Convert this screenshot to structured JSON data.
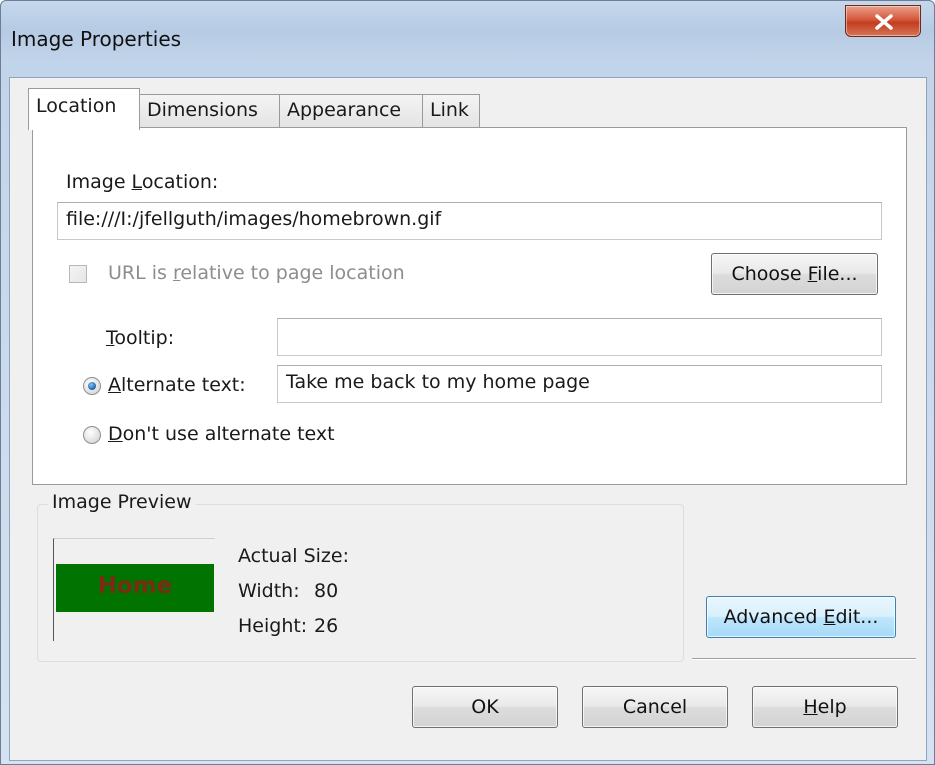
{
  "window": {
    "title": "Image Properties",
    "close_label": "X"
  },
  "tabs": [
    {
      "label": "Location",
      "active": true
    },
    {
      "label": "Dimensions",
      "active": false
    },
    {
      "label": "Appearance",
      "active": false
    },
    {
      "label": "Link",
      "active": false
    }
  ],
  "location": {
    "image_location_label_pre": "Image ",
    "image_location_label_key": "L",
    "image_location_label_post": "ocation:",
    "image_location_value": "file:///I:/jfellguth/images/homebrown.gif",
    "relative_label_pre": "URL is ",
    "relative_label_key": "r",
    "relative_label_post": "elative to page location",
    "relative_checked": false,
    "choose_file_pre": "Choose ",
    "choose_file_key": "F",
    "choose_file_post": "ile...",
    "tooltip_label_key": "T",
    "tooltip_label_post": "ooltip:",
    "tooltip_value": "",
    "alt_text_label_key": "A",
    "alt_text_label_post": "lternate text:",
    "alt_text_value": "Take me back to my home page",
    "no_alt_label_key": "D",
    "no_alt_label_post": "on't use alternate text",
    "selected_option": "alternate-text"
  },
  "preview": {
    "legend": "Image Preview",
    "image_text": "Home",
    "actual_size_label": "Actual Size:",
    "width_label": "Width:",
    "width_value": "80",
    "height_label": "Height:",
    "height_value": "26"
  },
  "buttons": {
    "advanced_edit_pre": "Advanced ",
    "advanced_edit_key": "E",
    "advanced_edit_post": "dit...",
    "ok": "OK",
    "cancel": "Cancel",
    "help_key": "H",
    "help_post": "elp"
  },
  "colors": {
    "preview_bg": "#007300",
    "preview_text": "#7a2b14",
    "close_button": "#c94a2c"
  }
}
